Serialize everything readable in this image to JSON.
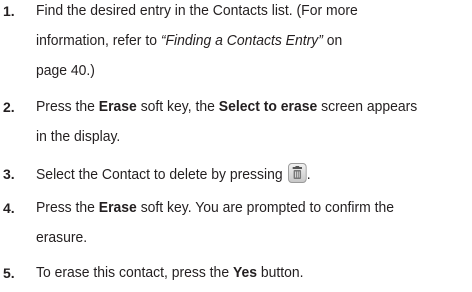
{
  "steps": [
    {
      "number": "1.",
      "lines": [
        [
          "Find the desired entry in the Contacts list. (For more"
        ],
        [
          "information, refer to ",
          "“Finding a Contacts Entry”",
          " on"
        ],
        [
          "page 40.)"
        ]
      ]
    },
    {
      "number": "2.",
      "lines": [
        [
          "Press the ",
          "Erase",
          " soft key, the ",
          "Select to erase",
          " screen appears"
        ],
        [
          "in the display."
        ]
      ]
    },
    {
      "number": "3.",
      "lines": [
        [
          "Select the Contact to delete by pressing",
          "."
        ]
      ]
    },
    {
      "number": "4.",
      "lines": [
        [
          "Press the ",
          "Erase",
          " soft key. You are prompted to confirm the"
        ],
        [
          "erasure."
        ]
      ]
    },
    {
      "number": "5.",
      "lines": [
        [
          "To erase this contact, press the ",
          "Yes",
          " button."
        ]
      ]
    }
  ],
  "icons": {
    "trash_key": "trash-can-icon"
  }
}
